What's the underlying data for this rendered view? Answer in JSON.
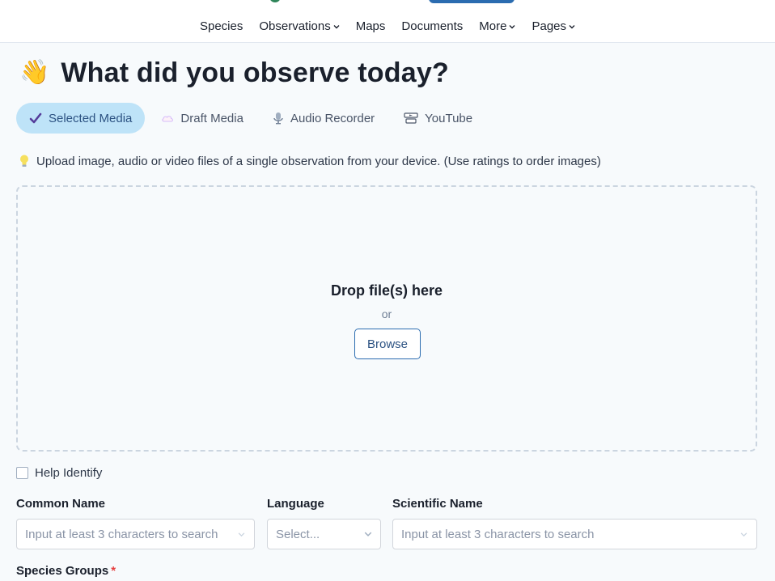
{
  "nav": {
    "items": [
      {
        "label": "Species",
        "dropdown": false
      },
      {
        "label": "Observations",
        "dropdown": true
      },
      {
        "label": "Maps",
        "dropdown": false
      },
      {
        "label": "Documents",
        "dropdown": false
      },
      {
        "label": "More",
        "dropdown": true
      },
      {
        "label": "Pages",
        "dropdown": true
      }
    ]
  },
  "page": {
    "emoji": "👋",
    "title": "What did you observe today?"
  },
  "tabs": [
    {
      "label": "Selected Media",
      "icon": "check-icon",
      "active": true
    },
    {
      "label": "Draft Media",
      "icon": "cloud-icon",
      "active": false
    },
    {
      "label": "Audio Recorder",
      "icon": "microphone-icon",
      "active": false
    },
    {
      "label": "YouTube",
      "icon": "youtube-icon",
      "active": false
    }
  ],
  "hint": {
    "icon": "lightbulb-icon",
    "text": "Upload image, audio or video files of a single observation from your device. (Use ratings to order images)"
  },
  "dropzone": {
    "title": "Drop file(s) here",
    "or": "or",
    "browse_label": "Browse"
  },
  "help_identify": {
    "label": "Help Identify",
    "checked": false
  },
  "form": {
    "common_name": {
      "label": "Common Name",
      "placeholder": "Input at least 3 characters to search"
    },
    "language": {
      "label": "Language",
      "placeholder": "Select..."
    },
    "scientific_name": {
      "label": "Scientific Name",
      "placeholder": "Input at least 3 characters to search"
    },
    "species_groups": {
      "label": "Species Groups",
      "required_mark": "*"
    }
  },
  "colors": {
    "accent": "#2b6cb0",
    "active_tab_bg": "#bee3f8",
    "required": "#e53e3e"
  }
}
